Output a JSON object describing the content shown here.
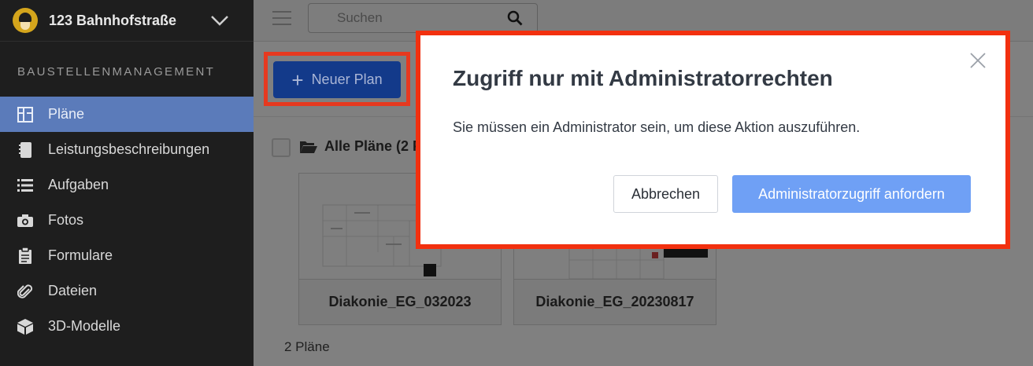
{
  "sidebar": {
    "project_name": "123 Bahnhofstraße",
    "section_title": "BAUSTELLENMANAGEMENT",
    "items": [
      {
        "label": "Pläne",
        "icon": "floorplan-icon",
        "active": true
      },
      {
        "label": "Leistungsbeschreibungen",
        "icon": "notebook-icon",
        "active": false
      },
      {
        "label": "Aufgaben",
        "icon": "list-icon",
        "active": false
      },
      {
        "label": "Fotos",
        "icon": "camera-icon",
        "active": false
      },
      {
        "label": "Formulare",
        "icon": "clipboard-icon",
        "active": false
      },
      {
        "label": "Dateien",
        "icon": "paperclip-icon",
        "active": false
      },
      {
        "label": "3D-Modelle",
        "icon": "cube-icon",
        "active": false
      }
    ]
  },
  "topbar": {
    "search_placeholder": "Suchen"
  },
  "toolbar": {
    "new_plan_label": "Neuer Plan",
    "new_plan_plus": "+"
  },
  "plans": {
    "folder_label": "Alle Pläne (2 P",
    "cards": [
      {
        "name": "Diakonie_EG_032023"
      },
      {
        "name": "Diakonie_EG_20230817"
      }
    ],
    "count_label": "2 Pläne"
  },
  "modal": {
    "title": "Zugriff nur mit Administratorrechten",
    "body": "Sie müssen ein Administrator sein, um diese Aktion auszuführen.",
    "cancel_label": "Abbrechen",
    "request_label": "Administratorzugriff anfordern"
  },
  "colors": {
    "active_nav": "#5b7bba",
    "primary_button": "#133a8a",
    "request_button": "#6fa0f5",
    "highlight": "#e6391f"
  }
}
